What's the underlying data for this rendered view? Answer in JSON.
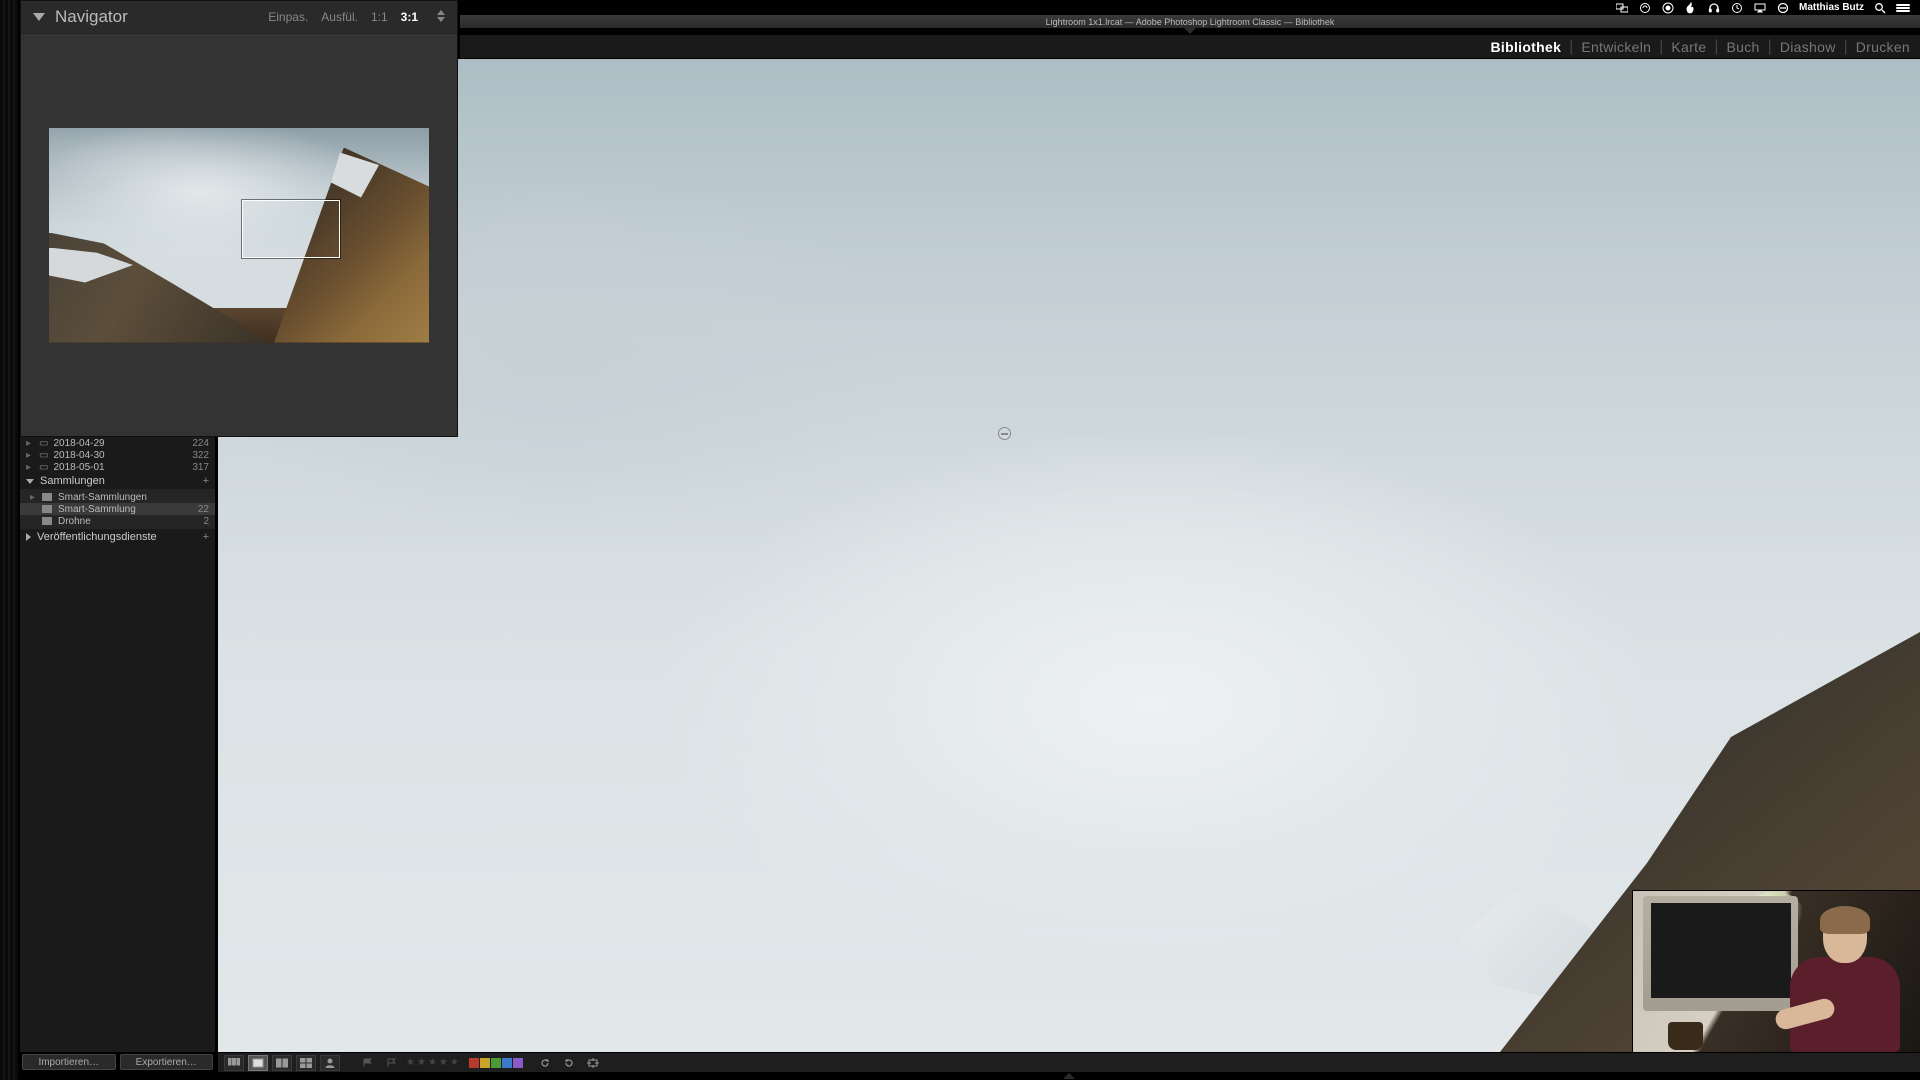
{
  "menubar": {
    "user": "Matthias Butz",
    "icons": [
      "screens-icon",
      "cloud-sync-icon",
      "adobe-cc-icon",
      "flame-icon",
      "headphones-icon",
      "time-machine-icon",
      "airplay-icon",
      "do-not-disturb-icon",
      "search-icon",
      "menu-icon"
    ]
  },
  "document": {
    "title": "Lightroom 1x1.lrcat — Adobe Photoshop Lightroom Classic — Bibliothek"
  },
  "modules": {
    "items": [
      "Bibliothek",
      "Entwickeln",
      "Karte",
      "Buch",
      "Diashow",
      "Drucken"
    ],
    "active": "Bibliothek"
  },
  "navigator": {
    "title": "Navigator",
    "zoom": {
      "fit": "Einpas.",
      "fill": "Ausfül.",
      "one": "1:1",
      "ratio": "3:1",
      "selected": "3:1"
    }
  },
  "folders": {
    "items": [
      {
        "name": "2018-04-29",
        "count": "224"
      },
      {
        "name": "2018-04-30",
        "count": "322"
      },
      {
        "name": "2018-05-01",
        "count": "317"
      }
    ]
  },
  "collections": {
    "header": "Sammlungen",
    "items": [
      {
        "name": "Smart-Sammlungen",
        "count": "",
        "expandable": true
      },
      {
        "name": "Smart-Sammlung",
        "count": "22",
        "selected": true
      },
      {
        "name": "Drohne",
        "count": "2"
      }
    ]
  },
  "publish": {
    "header": "Veröffentlichungsdienste"
  },
  "buttons": {
    "import": "Importieren…",
    "export": "Exportieren…"
  },
  "toolbar": {
    "colors": [
      "#b83a2a",
      "#c9a32a",
      "#4a9a3a",
      "#3a7ac9",
      "#8a5ac9"
    ]
  }
}
